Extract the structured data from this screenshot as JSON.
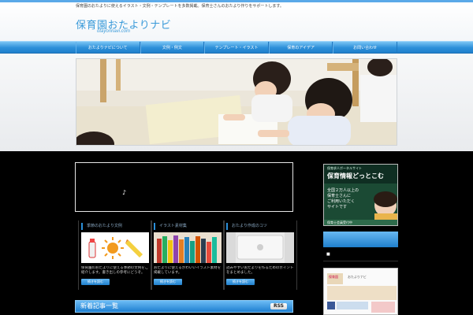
{
  "header": {
    "tagline": "保育園のおたよりに使えるイラスト・文例・テンプレートを多数掲載。保育士さんのおたより作りをサポートします。",
    "title": "保育園おたよりナビ",
    "subtitle": "otayorinavi.com"
  },
  "nav": {
    "items": [
      {
        "label": "おたよりナビについて"
      },
      {
        "label": "文例・例文"
      },
      {
        "label": "テンプレート・イラスト"
      },
      {
        "label": "保育のアイデア"
      },
      {
        "label": "お問い合わせ"
      }
    ]
  },
  "video": {
    "note": "♪"
  },
  "cards": [
    {
      "title": "季節のおたより文例",
      "text": "保育園のおたよりに使える季節の文例をご紹介します。書き出しの参考にどうぞ。",
      "button": "続きを読む"
    },
    {
      "title": "イラスト素材集",
      "text": "おたよりに使えるかわいいイラスト素材を掲載しています。",
      "button": "続きを読む"
    },
    {
      "title": "おたより作成のコツ",
      "text": "読みやすいおたよりを作るためのポイントをまとめました。",
      "button": "続きを読む"
    }
  ],
  "section": {
    "title": "新着記事一覧",
    "rss_label": "RSS"
  },
  "sidebar": {
    "banner1": {
      "caption": "保育求人ポータルサイト",
      "headline": "保育情報どっとこむ",
      "line1": "全国２万人以上の",
      "line2": "保育士さんに",
      "line3": "ご利用いただく",
      "line4": "サイトです",
      "footer": "保育士会員受付中"
    },
    "small_text": "■",
    "banner2": {
      "badge": "保育園",
      "text": "おたよりナビ"
    }
  },
  "colors": {
    "accent": "#2b8fd9",
    "nav_top": "#7ac4f4",
    "nav_bottom": "#1f7fcc",
    "title_blue": "#3a9ad9"
  }
}
